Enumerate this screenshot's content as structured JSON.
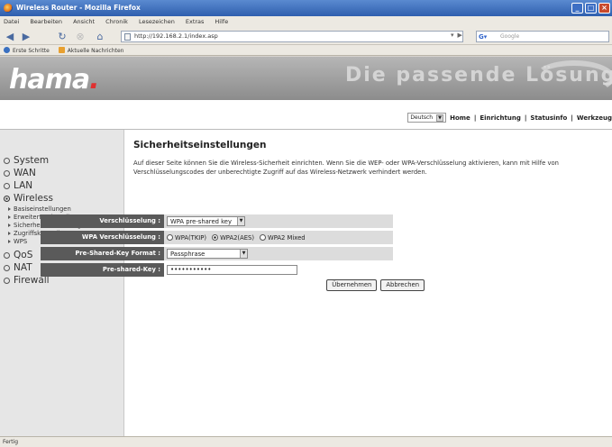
{
  "window": {
    "title": "Wireless Router - Mozilla Firefox"
  },
  "menu": [
    "Datei",
    "Bearbeiten",
    "Ansicht",
    "Chronik",
    "Lesezeichen",
    "Extras",
    "Hilfe"
  ],
  "navbar": {
    "url": "http://192.168.2.1/index.asp",
    "search_placeholder": "Google"
  },
  "bookmarks": [
    "Erste Schritte",
    "Aktuelle Nachrichten"
  ],
  "header": {
    "logo": "hama",
    "logo_dot": ".",
    "slogan": "Die passende Lösung",
    "language": "Deutsch",
    "nav": [
      "Home",
      "Einrichtung",
      "Statusinfo",
      "Werkzeug"
    ]
  },
  "sidebar": {
    "items": [
      {
        "label": "System"
      },
      {
        "label": "WAN"
      },
      {
        "label": "LAN"
      },
      {
        "label": "Wireless"
      }
    ],
    "wireless_sub": [
      "Basiseinstellungen",
      "Erweiterte Einstellungen",
      "Sicherheitseinstellungen",
      "Zugriffskontrolle",
      "WPS"
    ],
    "items_after": [
      {
        "label": "QoS"
      },
      {
        "label": "NAT"
      },
      {
        "label": "Firewall"
      }
    ]
  },
  "main": {
    "title": "Sicherheitseinstellungen",
    "description": "Auf dieser Seite können Sie die Wireless-Sicherheit einrichten. Wenn Sie die WEP- oder WPA-Verschlüsselung aktivieren, kann mit Hilfe von Verschlüsselungscodes der unberechtigte Zugriff auf das Wireless-Netzwerk verhindert werden."
  },
  "form": {
    "encryption_label": "Verschlüsselung :",
    "encryption_value": "WPA pre-shared key",
    "wpa_label": "WPA Verschlüsselung :",
    "wpa_options": [
      "WPA(TKIP)",
      "WPA2(AES)",
      "WPA2 Mixed"
    ],
    "wpa_selected": "WPA2(AES)",
    "psk_format_label": "Pre-Shared-Key Format :",
    "psk_format_value": "Passphrase",
    "psk_label": "Pre-shared-Key :",
    "psk_value": "•••••••••••",
    "apply_button": "Übernehmen",
    "cancel_button": "Abbrechen"
  },
  "status": {
    "text": "Fertig"
  }
}
